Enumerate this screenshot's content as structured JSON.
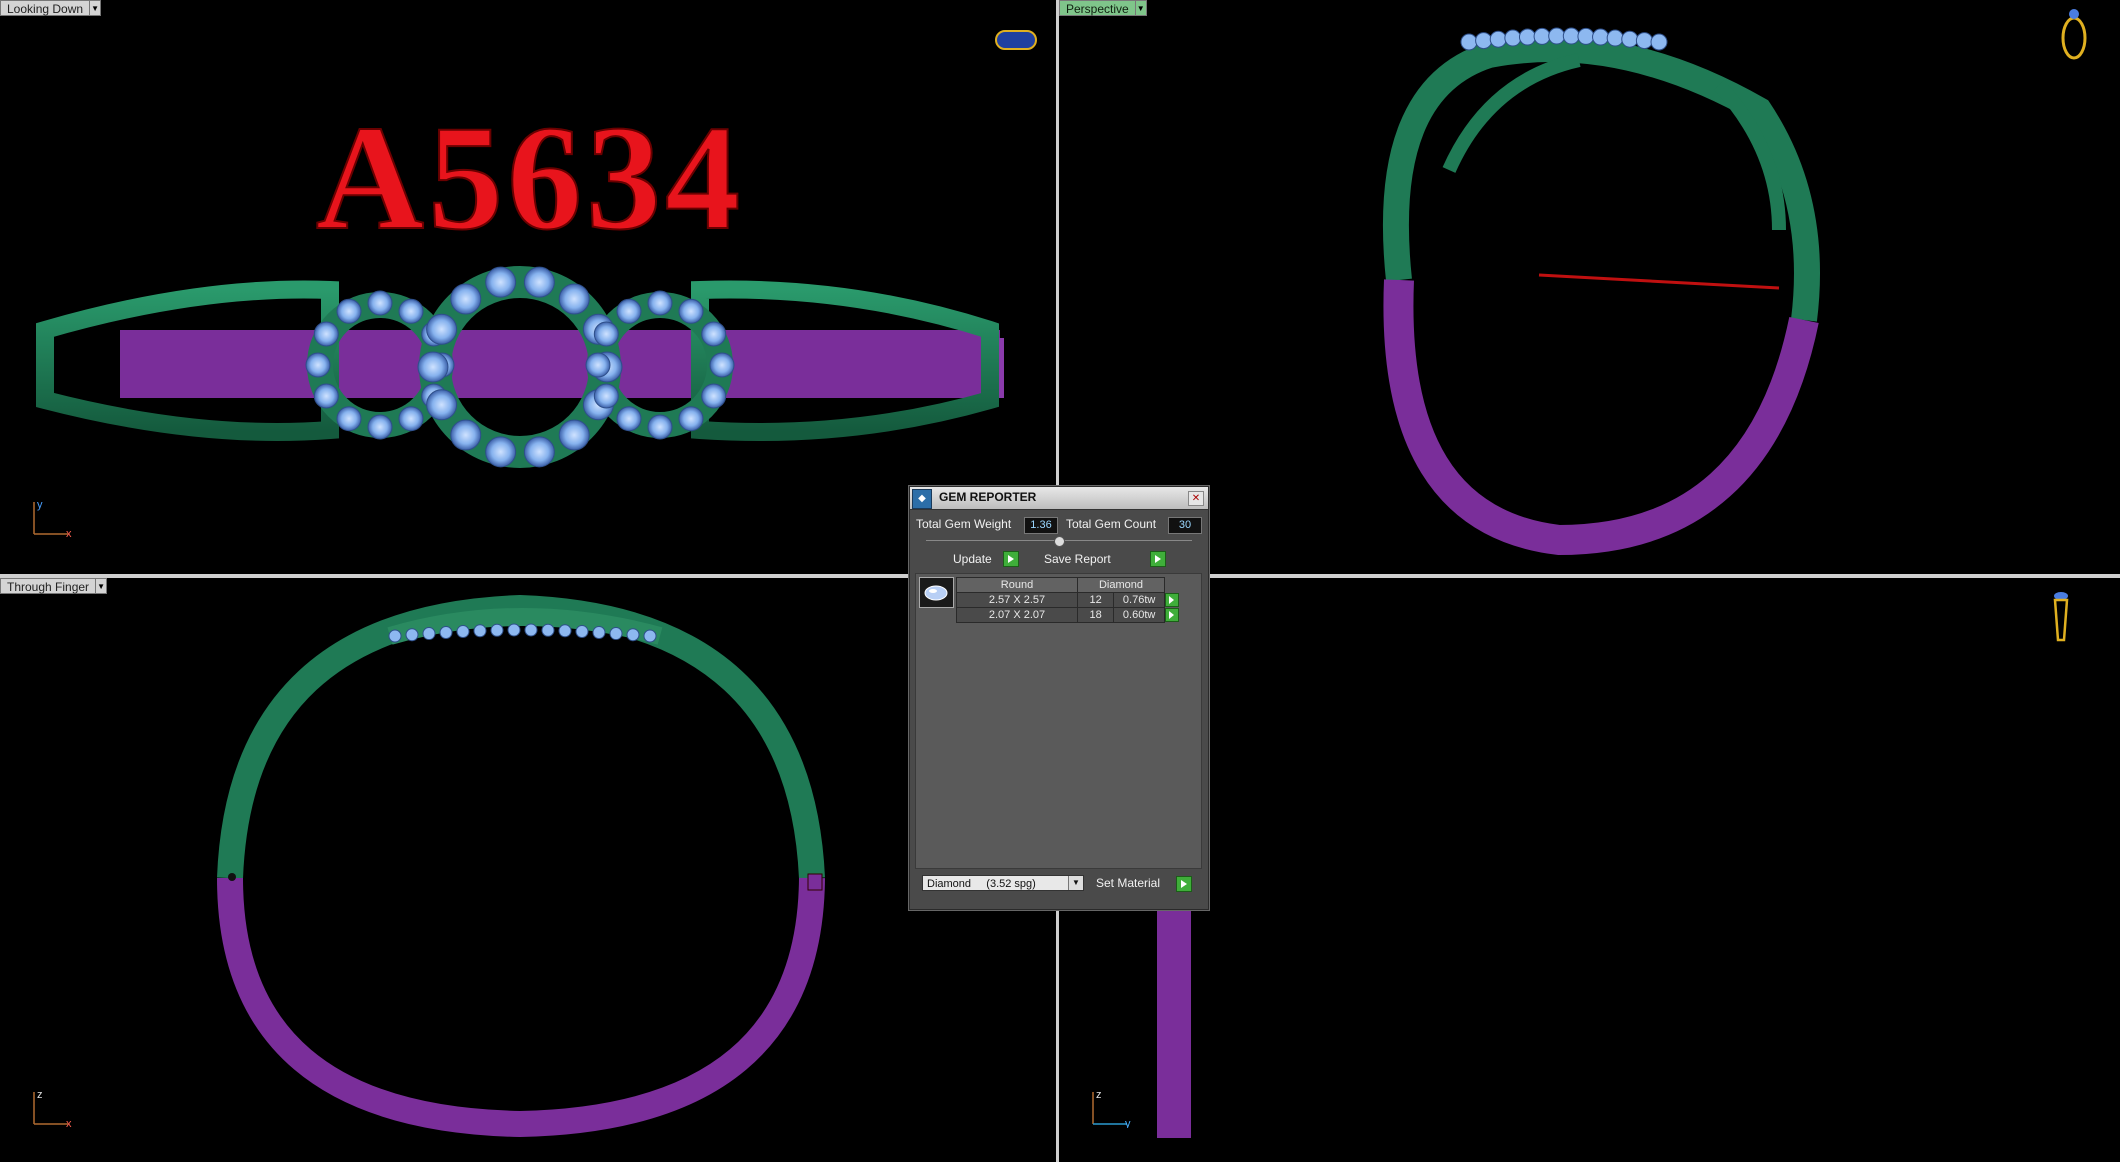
{
  "viewports": {
    "top_left": {
      "label": "Looking Down",
      "axes": {
        "vertical": "y",
        "horizontal": "x"
      },
      "model_text": "A5634"
    },
    "top_right": {
      "label": "Perspective"
    },
    "bottom_left": {
      "label": "Through Finger",
      "axes": {
        "vertical": "z",
        "horizontal": "x"
      }
    },
    "bottom_right": {
      "axes": {
        "vertical": "z",
        "horizontal": "y"
      }
    }
  },
  "gem_reporter": {
    "title": "GEM REPORTER",
    "total_weight_label": "Total Gem Weight",
    "total_weight_value": "1.36",
    "total_count_label": "Total Gem Count",
    "total_count_value": "30",
    "update_label": "Update",
    "save_report_label": "Save Report",
    "columns": [
      "Round",
      "Diamond"
    ],
    "rows": [
      {
        "size": "2.57 X 2.57",
        "count": "12",
        "weight": "0.76tw"
      },
      {
        "size": "2.07 X 2.07",
        "count": "18",
        "weight": "0.60tw"
      }
    ],
    "material_value": "Diamond     (3.52 spg)",
    "set_material_label": "Set Material"
  },
  "colors": {
    "metal_green": "#1f7a55",
    "metal_purple": "#7a2e9a",
    "gem_blue": "#8db8f0",
    "text_red": "#e8141c"
  }
}
